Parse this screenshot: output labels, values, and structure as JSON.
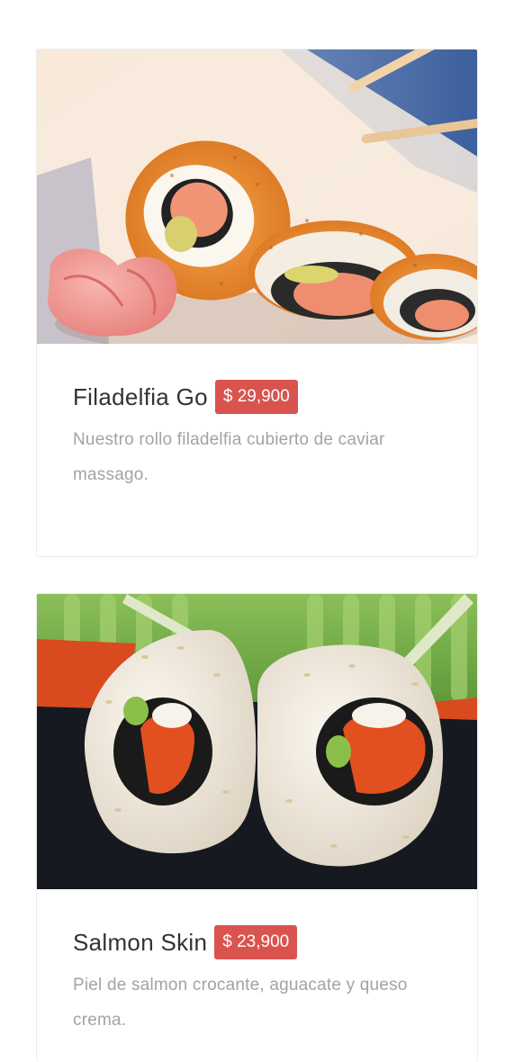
{
  "menu": {
    "items": [
      {
        "name": "Filadelfia Go",
        "price": "$ 29,900",
        "description": "Nuestro rollo filadelfia cubierto de caviar massago.",
        "image_icon": "sushi-roll-photo"
      },
      {
        "name": "Salmon Skin",
        "price": "$ 23,900",
        "description": "Piel de salmon crocante, aguacate y queso crema.",
        "image_icon": "sushi-roll-photo"
      }
    ]
  },
  "colors": {
    "price_badge": "#d9534f",
    "title_text": "#333333",
    "description_text": "#a3a3a3",
    "card_border": "#ececec",
    "background": "#ffffff"
  }
}
